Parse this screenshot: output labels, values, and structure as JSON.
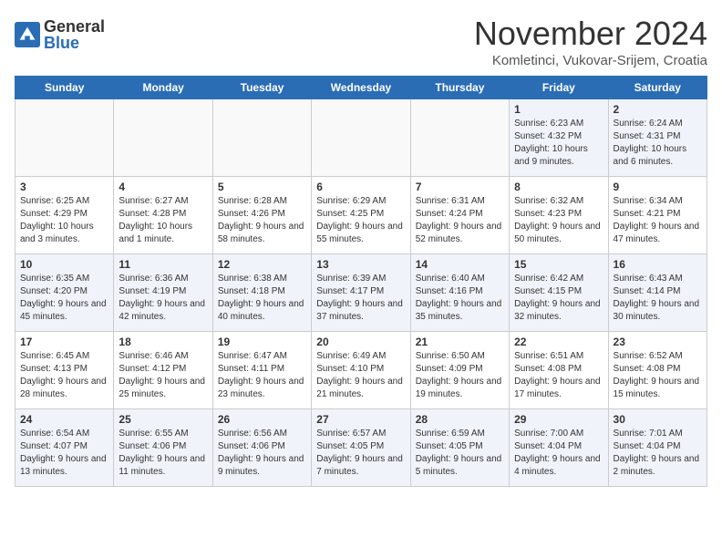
{
  "header": {
    "logo_general": "General",
    "logo_blue": "Blue",
    "month_title": "November 2024",
    "location": "Komletinci, Vukovar-Srijem, Croatia"
  },
  "weekdays": [
    "Sunday",
    "Monday",
    "Tuesday",
    "Wednesday",
    "Thursday",
    "Friday",
    "Saturday"
  ],
  "weeks": [
    [
      {
        "day": "",
        "info": ""
      },
      {
        "day": "",
        "info": ""
      },
      {
        "day": "",
        "info": ""
      },
      {
        "day": "",
        "info": ""
      },
      {
        "day": "",
        "info": ""
      },
      {
        "day": "1",
        "info": "Sunrise: 6:23 AM\nSunset: 4:32 PM\nDaylight: 10 hours and 9 minutes."
      },
      {
        "day": "2",
        "info": "Sunrise: 6:24 AM\nSunset: 4:31 PM\nDaylight: 10 hours and 6 minutes."
      }
    ],
    [
      {
        "day": "3",
        "info": "Sunrise: 6:25 AM\nSunset: 4:29 PM\nDaylight: 10 hours and 3 minutes."
      },
      {
        "day": "4",
        "info": "Sunrise: 6:27 AM\nSunset: 4:28 PM\nDaylight: 10 hours and 1 minute."
      },
      {
        "day": "5",
        "info": "Sunrise: 6:28 AM\nSunset: 4:26 PM\nDaylight: 9 hours and 58 minutes."
      },
      {
        "day": "6",
        "info": "Sunrise: 6:29 AM\nSunset: 4:25 PM\nDaylight: 9 hours and 55 minutes."
      },
      {
        "day": "7",
        "info": "Sunrise: 6:31 AM\nSunset: 4:24 PM\nDaylight: 9 hours and 52 minutes."
      },
      {
        "day": "8",
        "info": "Sunrise: 6:32 AM\nSunset: 4:23 PM\nDaylight: 9 hours and 50 minutes."
      },
      {
        "day": "9",
        "info": "Sunrise: 6:34 AM\nSunset: 4:21 PM\nDaylight: 9 hours and 47 minutes."
      }
    ],
    [
      {
        "day": "10",
        "info": "Sunrise: 6:35 AM\nSunset: 4:20 PM\nDaylight: 9 hours and 45 minutes."
      },
      {
        "day": "11",
        "info": "Sunrise: 6:36 AM\nSunset: 4:19 PM\nDaylight: 9 hours and 42 minutes."
      },
      {
        "day": "12",
        "info": "Sunrise: 6:38 AM\nSunset: 4:18 PM\nDaylight: 9 hours and 40 minutes."
      },
      {
        "day": "13",
        "info": "Sunrise: 6:39 AM\nSunset: 4:17 PM\nDaylight: 9 hours and 37 minutes."
      },
      {
        "day": "14",
        "info": "Sunrise: 6:40 AM\nSunset: 4:16 PM\nDaylight: 9 hours and 35 minutes."
      },
      {
        "day": "15",
        "info": "Sunrise: 6:42 AM\nSunset: 4:15 PM\nDaylight: 9 hours and 32 minutes."
      },
      {
        "day": "16",
        "info": "Sunrise: 6:43 AM\nSunset: 4:14 PM\nDaylight: 9 hours and 30 minutes."
      }
    ],
    [
      {
        "day": "17",
        "info": "Sunrise: 6:45 AM\nSunset: 4:13 PM\nDaylight: 9 hours and 28 minutes."
      },
      {
        "day": "18",
        "info": "Sunrise: 6:46 AM\nSunset: 4:12 PM\nDaylight: 9 hours and 25 minutes."
      },
      {
        "day": "19",
        "info": "Sunrise: 6:47 AM\nSunset: 4:11 PM\nDaylight: 9 hours and 23 minutes."
      },
      {
        "day": "20",
        "info": "Sunrise: 6:49 AM\nSunset: 4:10 PM\nDaylight: 9 hours and 21 minutes."
      },
      {
        "day": "21",
        "info": "Sunrise: 6:50 AM\nSunset: 4:09 PM\nDaylight: 9 hours and 19 minutes."
      },
      {
        "day": "22",
        "info": "Sunrise: 6:51 AM\nSunset: 4:08 PM\nDaylight: 9 hours and 17 minutes."
      },
      {
        "day": "23",
        "info": "Sunrise: 6:52 AM\nSunset: 4:08 PM\nDaylight: 9 hours and 15 minutes."
      }
    ],
    [
      {
        "day": "24",
        "info": "Sunrise: 6:54 AM\nSunset: 4:07 PM\nDaylight: 9 hours and 13 minutes."
      },
      {
        "day": "25",
        "info": "Sunrise: 6:55 AM\nSunset: 4:06 PM\nDaylight: 9 hours and 11 minutes."
      },
      {
        "day": "26",
        "info": "Sunrise: 6:56 AM\nSunset: 4:06 PM\nDaylight: 9 hours and 9 minutes."
      },
      {
        "day": "27",
        "info": "Sunrise: 6:57 AM\nSunset: 4:05 PM\nDaylight: 9 hours and 7 minutes."
      },
      {
        "day": "28",
        "info": "Sunrise: 6:59 AM\nSunset: 4:05 PM\nDaylight: 9 hours and 5 minutes."
      },
      {
        "day": "29",
        "info": "Sunrise: 7:00 AM\nSunset: 4:04 PM\nDaylight: 9 hours and 4 minutes."
      },
      {
        "day": "30",
        "info": "Sunrise: 7:01 AM\nSunset: 4:04 PM\nDaylight: 9 hours and 2 minutes."
      }
    ]
  ]
}
